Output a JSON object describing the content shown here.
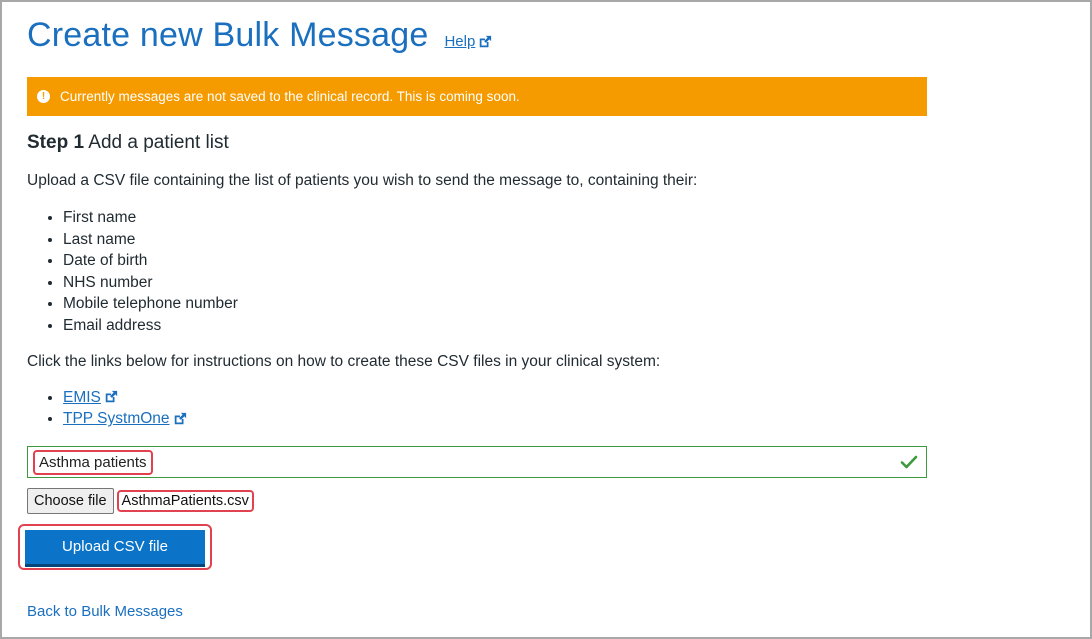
{
  "page": {
    "title": "Create new Bulk Message",
    "help_label": "Help"
  },
  "alert": {
    "text": "Currently messages are not saved to the clinical record. This is coming soon.",
    "icon": "warning-icon"
  },
  "step": {
    "number": "Step 1",
    "title": "Add a patient list"
  },
  "intro_text": "Upload a CSV file containing the list of patients you wish to send the message to, containing their:",
  "fields": [
    "First name",
    "Last name",
    "Date of birth",
    "NHS number",
    "Mobile telephone number",
    "Email address"
  ],
  "links_intro": "Click the links below for instructions on how to create these CSV files in your clinical system:",
  "links": [
    "EMIS",
    "TPP SystmOne"
  ],
  "list_name": {
    "value": "Asthma patients"
  },
  "file": {
    "button_label": "Choose file",
    "file_name": "AsthmaPatients.csv"
  },
  "upload_label": "Upload CSV file",
  "back_label": "Back to Bulk Messages",
  "colors": {
    "brand": "#1a6fbf",
    "alert": "#f59b00",
    "button": "#0b74c8",
    "success": "#3c9a3c",
    "highlight": "#e0434f"
  }
}
